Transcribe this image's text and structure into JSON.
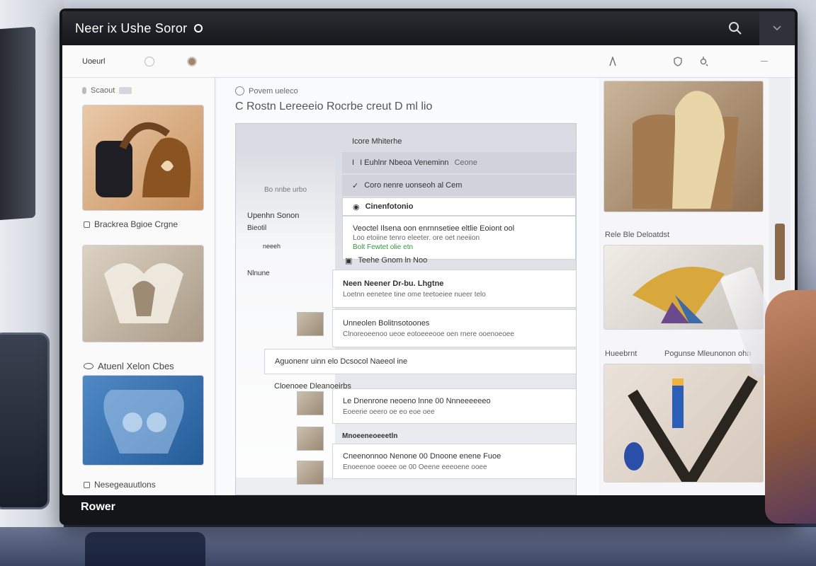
{
  "window": {
    "title": "Neer ix Ushe Soror"
  },
  "toolbar": {
    "left_label": "Uoeurl"
  },
  "sidebar": {
    "search_label": "Scaout",
    "cards": [
      {
        "label": "Brackrea Bgioe Crgne"
      },
      {
        "label": "Atuenl Xelon Cbes"
      },
      {
        "label": "Nesegeauutlons"
      }
    ]
  },
  "main": {
    "breadcrumb": "Povem ueleco",
    "heading": "C Rostn Lereeeio Rocrbe creut D ml lio"
  },
  "document": {
    "rows": [
      {
        "text": "Icore Mhiterhe"
      },
      {
        "text": "I Euhlnr Nbeoa Veneminn",
        "extra": "Ceone"
      },
      {
        "text": "Coro nenre uonseoh al Cem"
      },
      {
        "text": "Cinenfotonio"
      },
      {
        "text": "Veoctel Ilsena oon enrnnsetiee eltlie Eoiont ool",
        "sub1": "Loo etoiine tenro eleeter. ore oet neeiion",
        "sub2": "Bolt Fewtet olie etn",
        "green": true
      },
      {
        "text": "Teehe Gnom ln Noo"
      },
      {
        "text": "Neen Neener Dr-bu. Lhgtne",
        "sub1": "Loetnn eenetee tine ome teetoeiee nueer telo"
      },
      {
        "text": "Unneolen Bolitnsotoones",
        "sub1": "Clnoreoeenoo ueoe eotoeeeooe oen rnere ooenoeoee"
      },
      {
        "text": "Aguonenr uinn elo Dcsocol Naeeol ine"
      },
      {
        "text": "Cloenoee Dleanoeirbs"
      },
      {
        "text": "Le Dnenrone neoeno lnne 00 Nnneeeeeeo",
        "sub1": "Eoeerie oeero oe eo eoe oee"
      },
      {
        "text": "Mnoeeneoeeetln"
      },
      {
        "text": "Cneenonnoo Nenone 00 Dnoone enene Fuoe",
        "sub1": "Enoeenoe ooeee oe 00 Oeene eeeoene ooee"
      }
    ],
    "ghost_lines": [
      "Upenhn Sonon",
      "Bieotil",
      "neeeh",
      "Nlnune",
      "Bo nnbe urbo"
    ]
  },
  "gallery": {
    "captions": [
      "Rele Ble Deloatdst",
      "Hueebrnt",
      "Pogunse Mleunonon ohn"
    ]
  },
  "bezel": {
    "label": "Rower"
  },
  "icons": {
    "search": "search-icon",
    "menu": "chevron-down-icon",
    "user": "user-icon",
    "shield": "shield-icon",
    "gear": "gear-icon"
  }
}
